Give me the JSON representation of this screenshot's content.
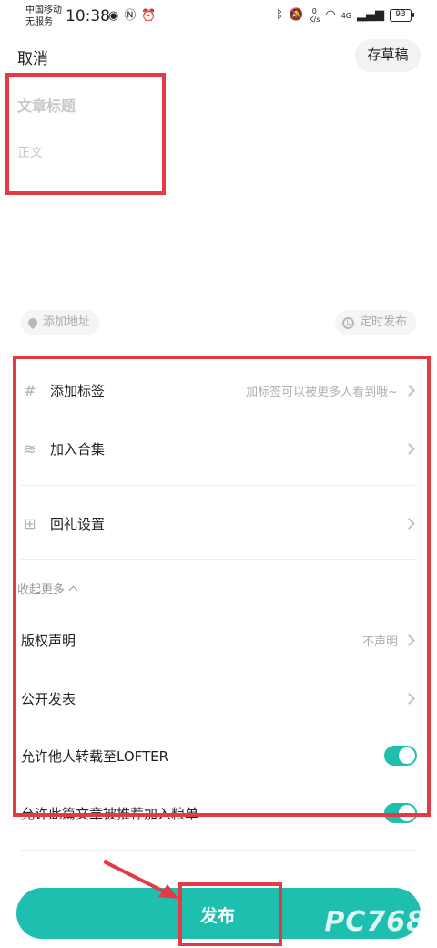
{
  "status_bar": {
    "carrier_line1": "中国移动",
    "carrier_line2": "无服务",
    "time": "10:38",
    "speed_value": "0",
    "speed_unit": "K/s",
    "network": "4G",
    "battery": "93"
  },
  "header": {
    "cancel_label": "取消",
    "draft_label": "存草稿"
  },
  "editor": {
    "title_placeholder": "文章标题",
    "body_placeholder": "正文"
  },
  "meta": {
    "location_label": "添加地址",
    "schedule_label": "定时发布"
  },
  "settings": {
    "tags_label": "添加标签",
    "tags_hint": "加标签可以被更多人看到哦~",
    "collection_label": "加入合集",
    "gift_label": "回礼设置",
    "collapse_label": "收起更多",
    "copyright_label": "版权声明",
    "copyright_value": "不声明",
    "visibility_label": "公开发表",
    "allow_repost_label": "允许他人转载至LOFTER",
    "allow_repost_on": true,
    "allow_recommend_label": "允许此篇文章被推荐加入粮单",
    "allow_recommend_on": true
  },
  "footer": {
    "publish_label": "发布"
  },
  "watermark": "PC768",
  "colors": {
    "accent": "#1fbfb0",
    "annotation": "#e53945"
  }
}
